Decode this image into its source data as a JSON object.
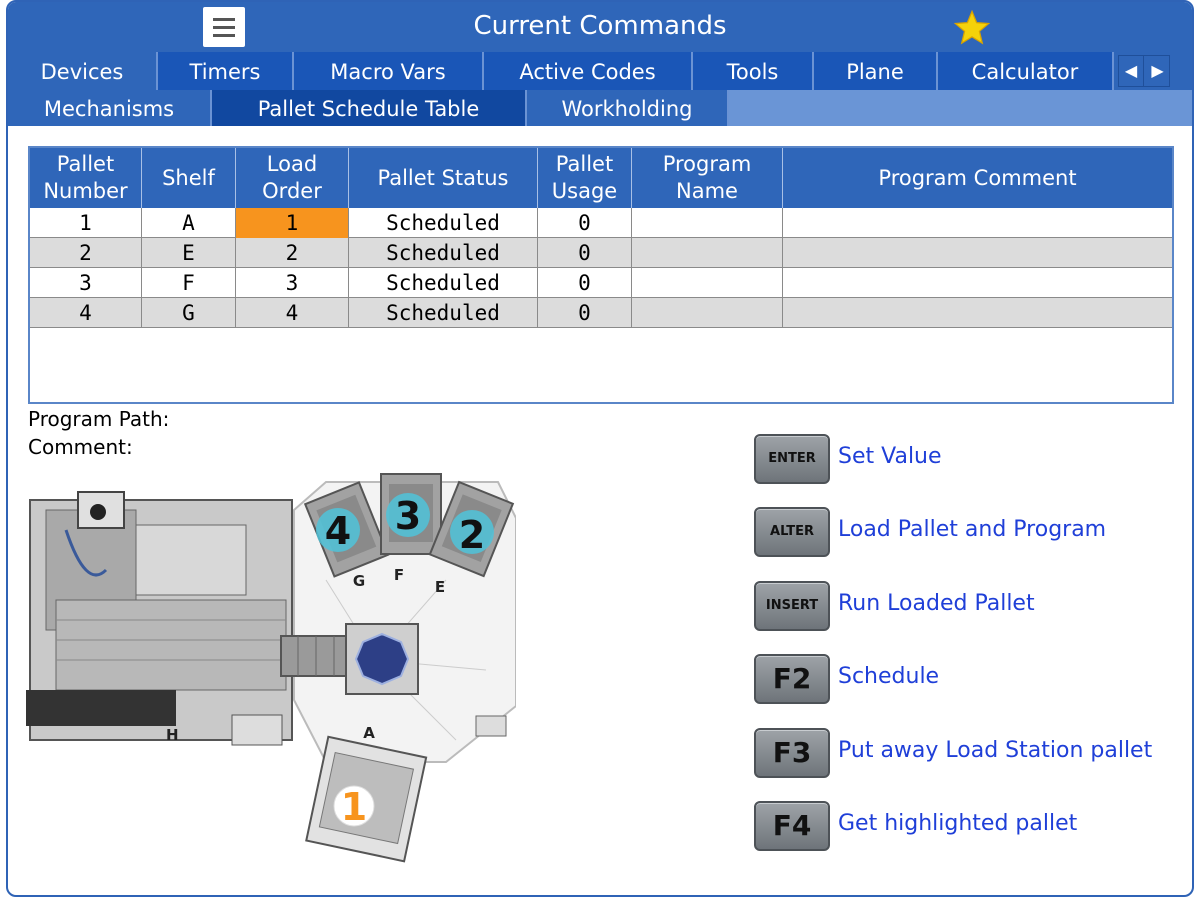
{
  "window": {
    "title": "Current Commands"
  },
  "tabs_primary": [
    "Devices",
    "Timers",
    "Macro Vars",
    "Active Codes",
    "Tools",
    "Plane",
    "Calculator"
  ],
  "tabs_secondary": [
    "Mechanisms",
    "Pallet Schedule Table",
    "Workholding"
  ],
  "table": {
    "headers": [
      "Pallet\nNumber",
      "Shelf",
      "Load\nOrder",
      "Pallet Status",
      "Pallet\nUsage",
      "Program\nName",
      "Program Comment"
    ],
    "rows": [
      [
        "1",
        "A",
        "1",
        "Scheduled",
        "0",
        "",
        ""
      ],
      [
        "2",
        "E",
        "2",
        "Scheduled",
        "0",
        "",
        ""
      ],
      [
        "3",
        "F",
        "3",
        "Scheduled",
        "0",
        "",
        ""
      ],
      [
        "4",
        "G",
        "4",
        "Scheduled",
        "0",
        "",
        ""
      ]
    ]
  },
  "info": {
    "program_path_label": "Program Path:",
    "comment_label": "Comment:"
  },
  "illustration": {
    "pallet_numbers": [
      "4",
      "3",
      "2",
      "1"
    ],
    "shelf_letters": [
      "G",
      "F",
      "E",
      "A",
      "H"
    ]
  },
  "keys": [
    {
      "key": "ENTER",
      "label": "Set Value"
    },
    {
      "key": "ALTER",
      "label": "Load Pallet and Program"
    },
    {
      "key": "INSERT",
      "label": "Run Loaded Pallet"
    },
    {
      "key": "F2",
      "label": "Schedule"
    },
    {
      "key": "F3",
      "label": "Put away Load Station pallet"
    },
    {
      "key": "F4",
      "label": "Get highlighted pallet"
    }
  ],
  "colors": {
    "header_blue": "#2f66b9",
    "active_tab_blue": "#1148a0",
    "selection_orange": "#f7941e",
    "key_label_blue": "#1f3fd8",
    "star_yellow": "#f5d20a"
  },
  "icons": {
    "menu": "hamburger-menu-icon",
    "favorite": "star-icon",
    "scroll_left": "arrow-left-icon",
    "scroll_right": "arrow-right-icon"
  }
}
